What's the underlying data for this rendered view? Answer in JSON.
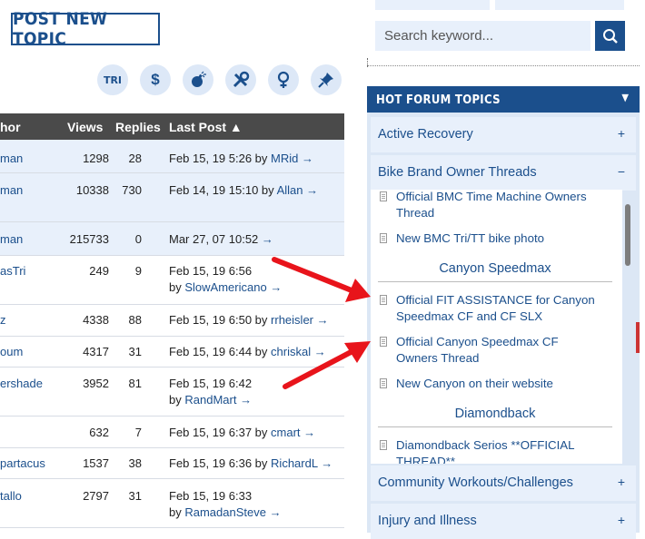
{
  "post_button": {
    "label": "POST NEW TOPIC"
  },
  "filter_icons": [
    {
      "name": "tri-icon",
      "text": "TRI"
    },
    {
      "name": "dollar-icon",
      "text": "$"
    },
    {
      "name": "bomb-icon"
    },
    {
      "name": "tools-icon"
    },
    {
      "name": "female-icon"
    },
    {
      "name": "pin-icon"
    }
  ],
  "table": {
    "headers": {
      "author": "hor",
      "views": "Views",
      "replies": "Replies",
      "last_post": "Last Post ▲"
    },
    "rows": [
      {
        "author": "man",
        "views": "1298",
        "replies": "28",
        "date": "Feb 15, 19 5:26 by",
        "by": "MRid",
        "highlight": true
      },
      {
        "author": "man",
        "views": "10338",
        "replies": "730",
        "date": "Feb 14, 19 15:10 by",
        "by": "Allan",
        "highlight": true
      },
      {
        "author": "man",
        "views": "215733",
        "replies": "0",
        "date": "Mar 27, 07 10:52",
        "by": "",
        "highlight": true
      },
      {
        "author": "asTri",
        "views": "249",
        "replies": "9",
        "date": "Feb 15, 19 6:56",
        "by2": "SlowAmericano",
        "highlight": false
      },
      {
        "author": "z",
        "views": "4338",
        "replies": "88",
        "date": "Feb 15, 19 6:50 by",
        "by": "rrheisler",
        "highlight": false
      },
      {
        "author": "oum",
        "views": "4317",
        "replies": "31",
        "date": "Feb 15, 19 6:44 by",
        "by": "chriskal",
        "highlight": false
      },
      {
        "author": "ershade",
        "views": "3952",
        "replies": "81",
        "date": "Feb 15, 19 6:42",
        "by2": "RandMart",
        "highlight": false
      },
      {
        "author": "",
        "views": "632",
        "replies": "7",
        "date": "Feb 15, 19 6:37 by",
        "by": "cmart",
        "highlight": false
      },
      {
        "author": "partacus",
        "views": "1537",
        "replies": "38",
        "date": "Feb 15, 19 6:36 by",
        "by": "RichardL",
        "highlight": false
      },
      {
        "author": "tallo",
        "views": "2797",
        "replies": "31",
        "date": "Feb 15, 19 6:33",
        "by2": "RamadanSteve",
        "highlight": false
      }
    ],
    "by_word": "by",
    "arrow": "→"
  },
  "search": {
    "placeholder": "Search keyword..."
  },
  "hot_topics": {
    "title": "HOT FORUM TOPICS",
    "categories": [
      {
        "label": "Active Recovery",
        "toggle": "+"
      },
      {
        "label": "Bike Brand Owner Threads",
        "toggle": "−"
      },
      {
        "label": "Community Workouts/Challenges",
        "toggle": "+"
      },
      {
        "label": "Injury and Illness",
        "toggle": "+"
      }
    ],
    "bmc_items": [
      "Official BMC Time Machine Owners Thread",
      "New BMC Tri/TT bike photo"
    ],
    "canyon_heading": "Canyon Speedmax",
    "canyon_items": [
      "Official FIT ASSISTANCE for Canyon Speedmax CF and CF SLX",
      "Official Canyon Speedmax CF Owners Thread",
      "New Canyon on their website"
    ],
    "diamondback_heading": "Diamondback",
    "diamondback_items": [
      "Diamondback Serios **OFFICIAL THREAD**"
    ]
  },
  "colors": {
    "brand": "#1b4f8c",
    "header_bg": "#4a4a4a",
    "highlight_row": "#e8f0fb",
    "annotation_arrow": "#e8141b"
  }
}
